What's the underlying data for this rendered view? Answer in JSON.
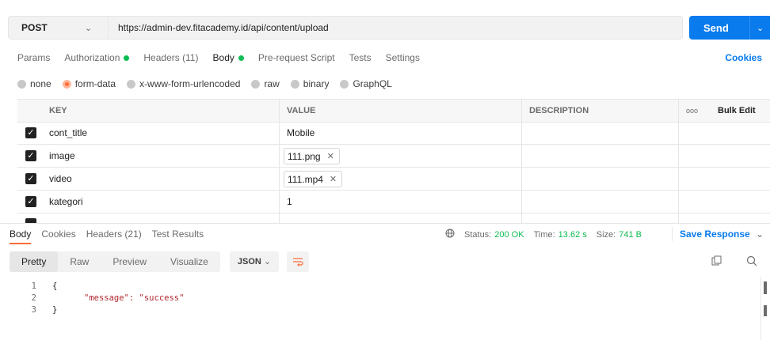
{
  "request": {
    "method": "POST",
    "url": "https://admin-dev.fitacademy.id/api/content/upload",
    "send_label": "Send"
  },
  "request_tabs": [
    {
      "label": "Params",
      "dot": false
    },
    {
      "label": "Authorization",
      "dot": true
    },
    {
      "label": "Headers (11)",
      "dot": false
    },
    {
      "label": "Body",
      "dot": true
    },
    {
      "label": "Pre-request Script",
      "dot": false
    },
    {
      "label": "Tests",
      "dot": false
    },
    {
      "label": "Settings",
      "dot": false
    }
  ],
  "cookies_label": "Cookies",
  "body_types": [
    "none",
    "form-data",
    "x-www-form-urlencoded",
    "raw",
    "binary",
    "GraphQL"
  ],
  "body_type_selected": "form-data",
  "table": {
    "headers": {
      "key": "KEY",
      "value": "VALUE",
      "description": "DESCRIPTION",
      "more": "ooo",
      "bulk_edit": "Bulk Edit"
    },
    "rows": [
      {
        "key": "cont_title",
        "value": "Mobile",
        "file": false
      },
      {
        "key": "image",
        "value": "111.png",
        "file": true
      },
      {
        "key": "video",
        "value": "111.mp4",
        "file": true
      },
      {
        "key": "kategori",
        "value": "1",
        "file": false
      }
    ]
  },
  "response": {
    "tabs": [
      "Body",
      "Cookies",
      "Headers (21)",
      "Test Results"
    ],
    "status_label": "Status:",
    "status_value": "200 OK",
    "time_label": "Time:",
    "time_value": "13.62 s",
    "size_label": "Size:",
    "size_value": "741 B",
    "save_label": "Save Response",
    "view_tabs": [
      "Pretty",
      "Raw",
      "Preview",
      "Visualize"
    ],
    "format": "JSON",
    "code_lines": [
      {
        "n": "1",
        "text": "{"
      },
      {
        "n": "2",
        "text": "\"message\": \"success\""
      },
      {
        "n": "3",
        "text": "}"
      }
    ]
  },
  "colors": {
    "accent": "#097bed",
    "orange": "#ff6c37",
    "green": "#0cbb52"
  }
}
